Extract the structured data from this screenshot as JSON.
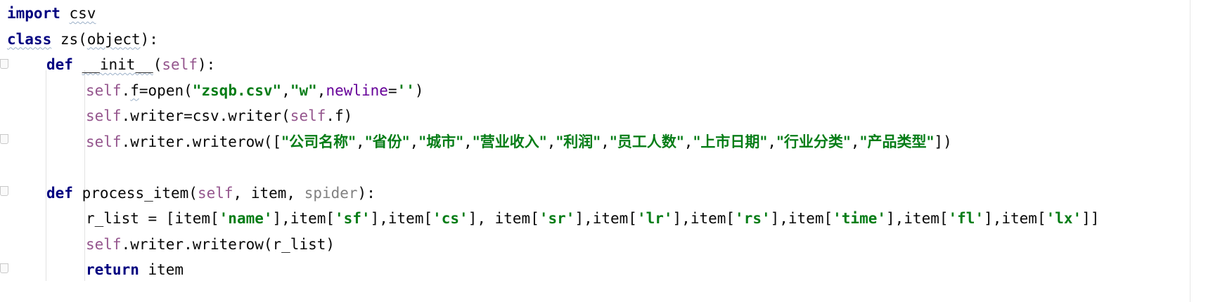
{
  "editor": {
    "language": "python",
    "lines": [
      {
        "indent": 0,
        "tokens": [
          {
            "t": "import",
            "s": "kw"
          },
          {
            "t": " "
          },
          {
            "t": "csv",
            "s": "sq"
          }
        ]
      },
      {
        "indent": 0,
        "tokens": [
          {
            "t": "class",
            "s": "kw sq"
          },
          {
            "t": " zs("
          },
          {
            "t": "object",
            "s": "sq"
          },
          {
            "t": "):"
          }
        ]
      },
      {
        "indent": 1,
        "tokens": [
          {
            "t": "def",
            "s": "kw"
          },
          {
            "t": " "
          },
          {
            "t": "__init__",
            "s": "sq"
          },
          {
            "t": "("
          },
          {
            "t": "self",
            "s": "selfc"
          },
          {
            "t": "):"
          }
        ]
      },
      {
        "indent": 2,
        "tokens": [
          {
            "t": "self",
            "s": "selfc"
          },
          {
            "t": "."
          },
          {
            "t": "f",
            "s": "sq"
          },
          {
            "t": "=open("
          },
          {
            "t": "\"zsqb.csv\"",
            "s": "str"
          },
          {
            "t": ","
          },
          {
            "t": "\"w\"",
            "s": "str"
          },
          {
            "t": ","
          },
          {
            "t": "newline",
            "s": "param"
          },
          {
            "t": "="
          },
          {
            "t": "''",
            "s": "str"
          },
          {
            "t": ")"
          }
        ]
      },
      {
        "indent": 2,
        "tokens": [
          {
            "t": "self",
            "s": "selfc"
          },
          {
            "t": ".writer=csv.writer("
          },
          {
            "t": "self",
            "s": "selfc"
          },
          {
            "t": ".f)"
          }
        ]
      },
      {
        "indent": 2,
        "tokens": [
          {
            "t": "self",
            "s": "selfc"
          },
          {
            "t": ".writer.writerow(["
          },
          {
            "t": "\"公司名称\"",
            "s": "str cn"
          },
          {
            "t": ","
          },
          {
            "t": "\"省份\"",
            "s": "str cn"
          },
          {
            "t": ","
          },
          {
            "t": "\"城市\"",
            "s": "str cn"
          },
          {
            "t": ","
          },
          {
            "t": "\"营业收入\"",
            "s": "str cn"
          },
          {
            "t": ","
          },
          {
            "t": "\"利润\"",
            "s": "str cn"
          },
          {
            "t": ","
          },
          {
            "t": "\"员工人数\"",
            "s": "str cn"
          },
          {
            "t": ","
          },
          {
            "t": "\"上市日期\"",
            "s": "str cn"
          },
          {
            "t": ","
          },
          {
            "t": "\"行业分类\"",
            "s": "str cn"
          },
          {
            "t": ","
          },
          {
            "t": "\"产品类型\"",
            "s": "str cn"
          },
          {
            "t": "])"
          }
        ]
      },
      {
        "indent": 0,
        "tokens": []
      },
      {
        "indent": 1,
        "tokens": [
          {
            "t": "def",
            "s": "kw"
          },
          {
            "t": " process_item("
          },
          {
            "t": "self",
            "s": "selfc"
          },
          {
            "t": ", item, "
          },
          {
            "t": "spider",
            "s": "unused"
          },
          {
            "t": "):"
          }
        ]
      },
      {
        "indent": 2,
        "tokens": [
          {
            "t": "r_list = [item["
          },
          {
            "t": "'name'",
            "s": "str"
          },
          {
            "t": "],item["
          },
          {
            "t": "'sf'",
            "s": "str"
          },
          {
            "t": "],item["
          },
          {
            "t": "'cs'",
            "s": "str"
          },
          {
            "t": "], item["
          },
          {
            "t": "'sr'",
            "s": "str"
          },
          {
            "t": "],item["
          },
          {
            "t": "'lr'",
            "s": "str"
          },
          {
            "t": "],item["
          },
          {
            "t": "'rs'",
            "s": "str"
          },
          {
            "t": "],item["
          },
          {
            "t": "'time'",
            "s": "str"
          },
          {
            "t": "],item["
          },
          {
            "t": "'fl'",
            "s": "str"
          },
          {
            "t": "],item["
          },
          {
            "t": "'lx'",
            "s": "str"
          },
          {
            "t": "]]"
          }
        ]
      },
      {
        "indent": 2,
        "tokens": [
          {
            "t": "self",
            "s": "selfc"
          },
          {
            "t": ".writer.writerow(r_list)"
          }
        ]
      },
      {
        "indent": 2,
        "tokens": [
          {
            "t": "return",
            "s": "kw"
          },
          {
            "t": " item"
          }
        ]
      }
    ]
  }
}
